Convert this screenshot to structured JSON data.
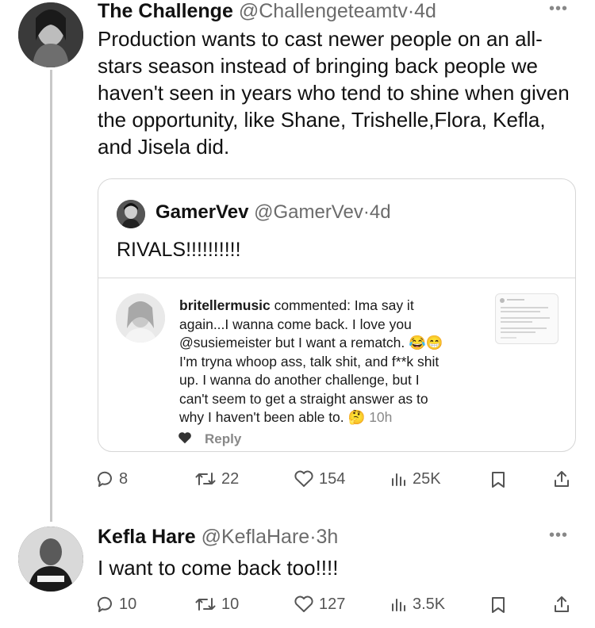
{
  "tweet1": {
    "author": "The Challenge",
    "handle": "@Challengeteamtv",
    "sep": "·",
    "time": "4d",
    "text": "Production wants to cast newer people on an all-stars season instead of bringing back people we haven't seen in years who tend to shine when given the opportunity, like Shane, Trishelle,Flora, Kefla, and Jisela did.",
    "quote": {
      "author": "GamerVev",
      "handle": "@GamerVev",
      "sep": "·",
      "time": "4d",
      "text": "RIVALS!!!!!!!!!!",
      "comment": {
        "username": "britellermusic",
        "line1_rest": " commented: Ima say it",
        "line2": "again...I wanna come back. I love you",
        "line3": "@susiemeister but I want a rematch. 😂😁",
        "line4": "I'm tryna whoop ass, talk shit, and f**k shit",
        "line5": "up. I wanna do another challenge, but I",
        "line6": "can't seem to get a straight answer as to",
        "line7": "why I haven't been able to. 🤔",
        "time": "10h",
        "reply": "Reply"
      }
    },
    "actions": {
      "replies": "8",
      "reposts": "22",
      "likes": "154",
      "views": "25K"
    }
  },
  "tweet2": {
    "author": "Kefla Hare",
    "handle": "@KeflaHare",
    "sep": "·",
    "time": "3h",
    "text": "I want to come back too!!!!",
    "actions": {
      "replies": "10",
      "reposts": "10",
      "likes": "127",
      "views": "3.5K"
    }
  },
  "icons": [
    "more-icon",
    "reply-icon",
    "repost-icon",
    "like-icon",
    "views-icon",
    "bookmark-icon",
    "share-icon",
    "heart-filled-icon"
  ]
}
